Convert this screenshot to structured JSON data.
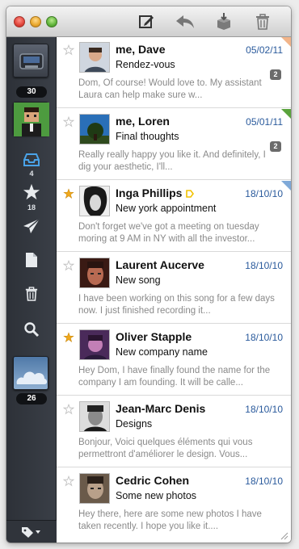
{
  "toolbar": {
    "compose_icon": "compose-icon",
    "reply_icon": "reply-icon",
    "archive_icon": "archive-icon",
    "trash_icon": "trash-icon"
  },
  "sidebar": {
    "accounts": [
      {
        "name": "inbox-account",
        "badge": "30"
      },
      {
        "name": "avatar-account"
      }
    ],
    "nav": [
      {
        "name": "inbox",
        "icon": "inbox-icon",
        "count": "4"
      },
      {
        "name": "starred",
        "icon": "star-icon",
        "count": "18"
      },
      {
        "name": "sent",
        "icon": "send-icon",
        "count": ""
      },
      {
        "name": "drafts",
        "icon": "document-icon",
        "count": ""
      },
      {
        "name": "trash",
        "icon": "trash-icon",
        "count": ""
      },
      {
        "name": "search",
        "icon": "search-icon",
        "count": ""
      }
    ],
    "cloud_account": {
      "badge": "26"
    },
    "footer_icon": "tag-menu-icon"
  },
  "messages": [
    {
      "sender": "me, Dave",
      "date": "05/02/11",
      "subject": "Rendez-vous",
      "preview": "Dom, Of course! Would love to. My assistant Laura can help make sure w...",
      "count": "2",
      "starred": false,
      "corner": "#f2b58a"
    },
    {
      "sender": "me, Loren",
      "date": "05/01/11",
      "subject": "Final thoughts",
      "preview": "Really really happy you like it. And definitely, I dig your aesthetic, I'll...",
      "count": "2",
      "starred": false,
      "corner": "#5aa33c"
    },
    {
      "sender": "Inga Phillips",
      "date": "18/10/10",
      "subject": "New york appointment",
      "preview": "Don't forget we've got a meeting on tuesday moring at 9 AM in NY with all the investor...",
      "count": "",
      "starred": true,
      "corner": "#7fa9d8",
      "label": true
    },
    {
      "sender": "Laurent Aucerve",
      "date": "18/10/10",
      "subject": "New song",
      "preview": "I have been working on this song for a few days now. I just finished recording it...",
      "count": "",
      "starred": false,
      "corner": ""
    },
    {
      "sender": "Oliver Stapple",
      "date": "18/10/10",
      "subject": "New company name",
      "preview": "Hey Dom, I have finally found the name for the company I am founding. It will be calle...",
      "count": "",
      "starred": true,
      "corner": ""
    },
    {
      "sender": "Jean-Marc Denis",
      "date": "18/10/10",
      "subject": "Designs",
      "preview": "Bonjour, Voici quelques éléments qui vous permettront d'améliorer le design. Vous...",
      "count": "",
      "starred": false,
      "corner": ""
    },
    {
      "sender": "Cedric Cohen",
      "date": "18/10/10",
      "subject": "Some new photos",
      "preview": "Hey there, here are some new photos I have taken recently. I hope you like it....",
      "count": "",
      "starred": false,
      "corner": ""
    }
  ],
  "colors": {
    "star_on": "#f0a81c",
    "star_off": "#cccccc",
    "date": "#2a5a9c",
    "label_yellow": "#f2c200"
  }
}
